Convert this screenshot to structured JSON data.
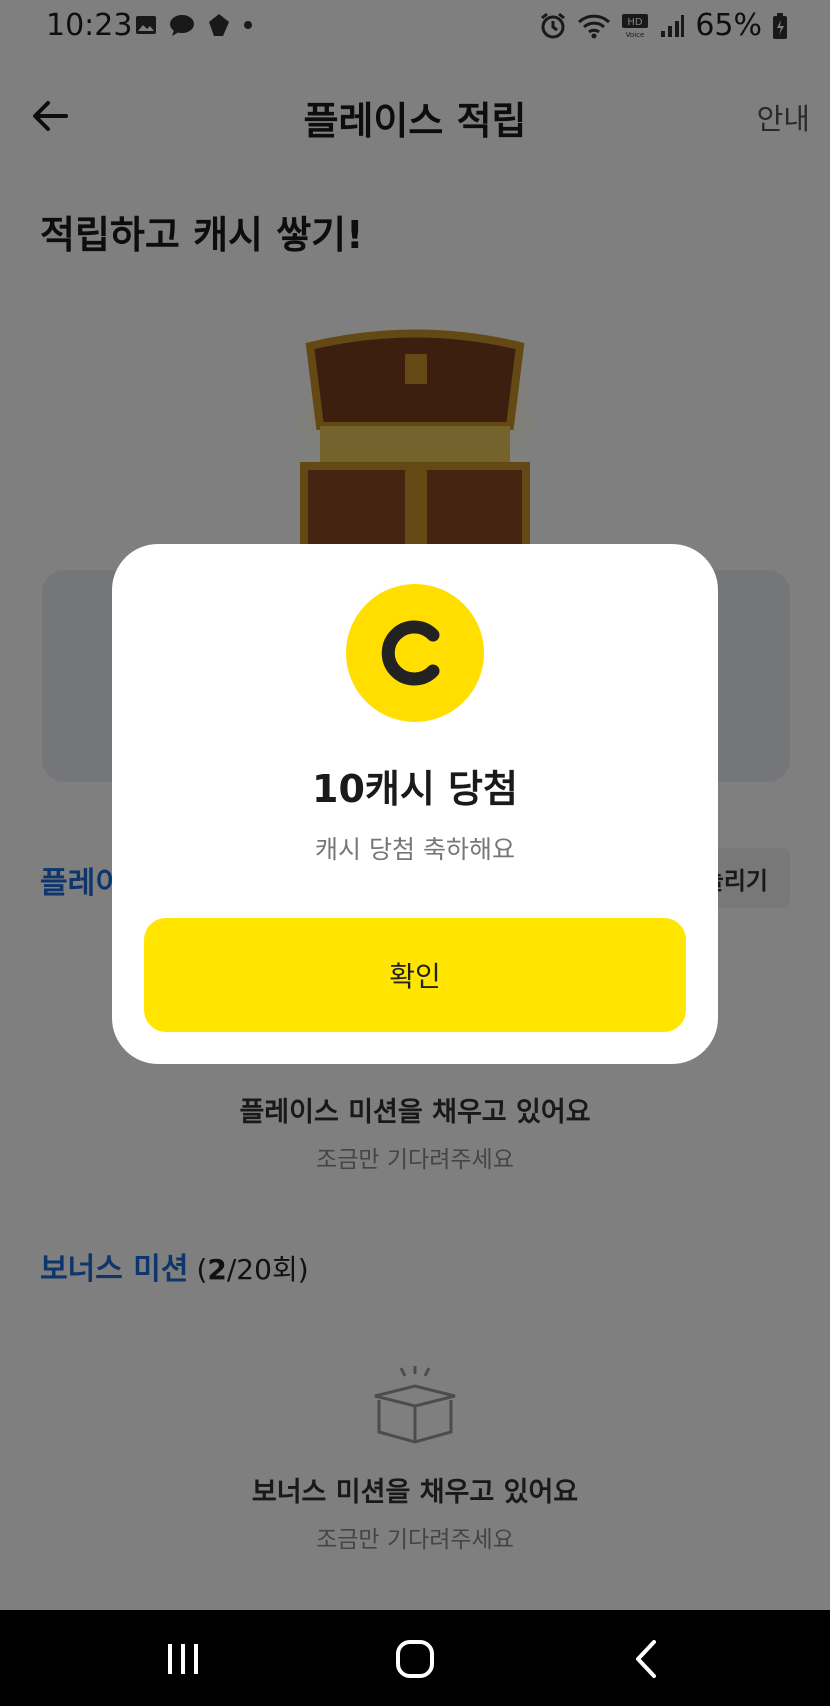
{
  "status_bar": {
    "time": "10:23",
    "battery": "65%",
    "left_icons": [
      "image-icon",
      "message-icon",
      "app-icon",
      "dot-icon"
    ],
    "right_icons": [
      "alarm-icon",
      "wifi-icon",
      "hd-voice-icon",
      "signal-icon",
      "battery-icon"
    ]
  },
  "header": {
    "title": "플레이스 적립",
    "guide": "안내"
  },
  "hero": {
    "title": "적립하고 캐시 쌓기!"
  },
  "place_section": {
    "title": "플레이",
    "button_label": "늘리기"
  },
  "place_empty": {
    "title": "플레이스 미션을 채우고 있어요",
    "subtitle": "조금만 기다려주세요"
  },
  "bonus_section": {
    "title": "보너스 미션",
    "count_open": "(",
    "count_current": "2",
    "count_rest": "/20회)"
  },
  "bonus_empty": {
    "title": "보너스 미션을 채우고 있어요",
    "subtitle": "조금만 기다려주세요"
  },
  "dialog": {
    "coin_letter": "C",
    "title": "10캐시 당첨",
    "message": "캐시 당첨 축하해요",
    "confirm": "확인"
  },
  "colors": {
    "accent_yellow": "#ffe500",
    "coin_yellow": "#ffde00",
    "link_blue": "#1d6ad8",
    "overlay": "rgba(0,0,0,0.5)"
  }
}
